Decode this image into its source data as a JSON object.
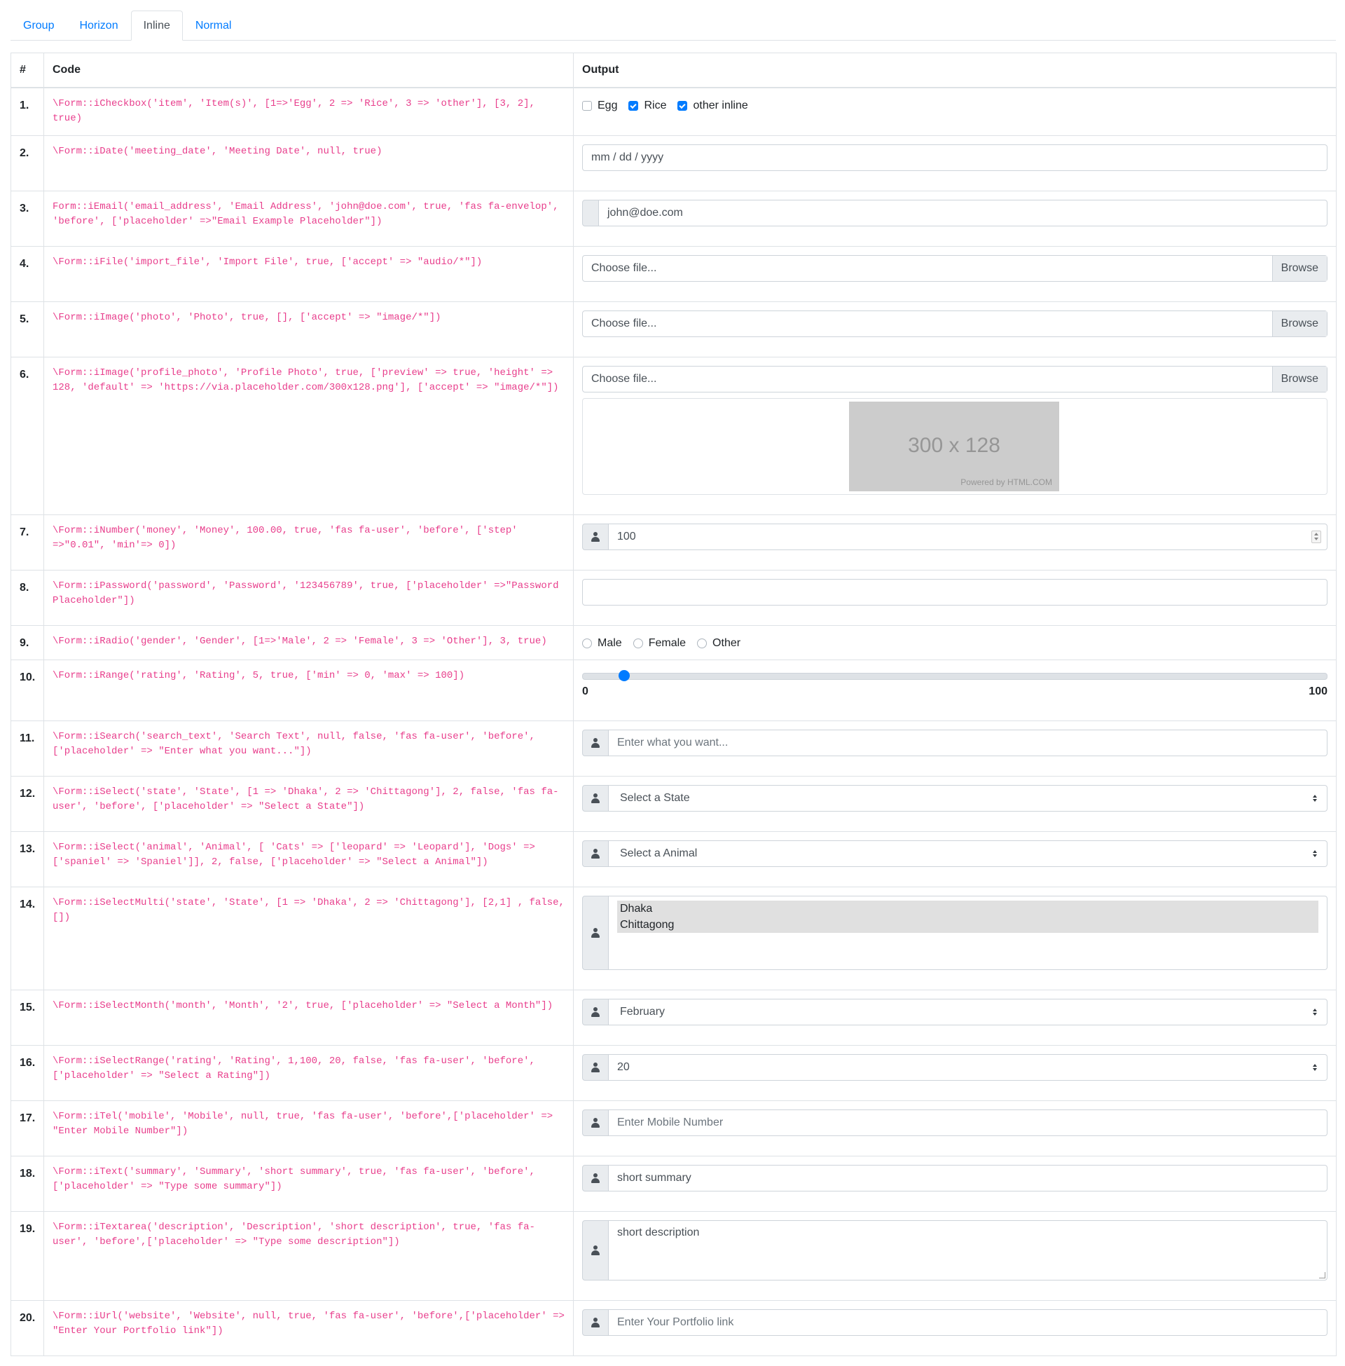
{
  "tabs": [
    {
      "label": "Group"
    },
    {
      "label": "Horizon"
    },
    {
      "label": "Inline"
    },
    {
      "label": "Normal"
    }
  ],
  "table": {
    "headers": {
      "num": "#",
      "code": "Code",
      "output": "Output"
    }
  },
  "rows": [
    {
      "num": "1.",
      "code": "\\Form::iCheckbox('item', 'Item(s)', [1=>'Egg', 2 => 'Rice', 3 => 'other'], [3, 2], true)",
      "options": [
        {
          "label": "Egg",
          "checked": false
        },
        {
          "label": "Rice",
          "checked": true
        },
        {
          "label": "other inline",
          "checked": true
        }
      ]
    },
    {
      "num": "2.",
      "code": "\\Form::iDate('meeting_date', 'Meeting Date', null, true)",
      "value": "mm / dd / yyyy"
    },
    {
      "num": "3.",
      "code": "Form::iEmail('email_address', 'Email Address', 'john@doe.com', true, 'fas fa-envelop', 'before', ['placeholder' =>\"Email Example Placeholder\"])",
      "value": "john@doe.com"
    },
    {
      "num": "4.",
      "code": "\\Form::iFile('import_file', 'Import File', true, ['accept' => \"audio/*\"])",
      "value": "Choose file...",
      "button": "Browse"
    },
    {
      "num": "5.",
      "code": "\\Form::iImage('photo', 'Photo', true, [], ['accept' => \"image/*\"])",
      "value": "Choose file...",
      "button": "Browse"
    },
    {
      "num": "6.",
      "code": "\\Form::iImage('profile_photo', 'Profile Photo', true, ['preview' => true, 'height' => 128, 'default' => 'https://via.placeholder.com/300x128.png'], ['accept' => \"image/*\"])",
      "value": "Choose file...",
      "button": "Browse",
      "preview_text": "300 x 128",
      "preview_credit": "Powered by HTML.COM"
    },
    {
      "num": "7.",
      "code": "\\Form::iNumber('money', 'Money', 100.00, true, 'fas fa-user', 'before', ['step' =>\"0.01\", 'min'=> 0])",
      "value": "100"
    },
    {
      "num": "8.",
      "code": "\\Form::iPassword('password', 'Password', '123456789', true, ['placeholder' =>\"Password Placeholder\"])",
      "value": ""
    },
    {
      "num": "9.",
      "code": "\\Form::iRadio('gender', 'Gender', [1=>'Male', 2 => 'Female', 3 => 'Other'], 3, true)",
      "options": [
        {
          "label": "Male"
        },
        {
          "label": "Female"
        },
        {
          "label": "Other"
        }
      ]
    },
    {
      "num": "10.",
      "code": "\\Form::iRange('rating', 'Rating', 5, true, ['min' => 0, 'max' => 100])",
      "min_label": "0",
      "max_label": "100",
      "value": 5
    },
    {
      "num": "11.",
      "code": "\\Form::iSearch('search_text', 'Search Text', null, false, 'fas fa-user', 'before', ['placeholder' => \"Enter what you want...\"])",
      "placeholder": "Enter what you want..."
    },
    {
      "num": "12.",
      "code": "\\Form::iSelect('state', 'State', [1 => 'Dhaka', 2 => 'Chittagong'], 2, false, 'fas fa-user', 'before', ['placeholder' => \"Select a State\"])",
      "value": "Select a State"
    },
    {
      "num": "13.",
      "code": "\\Form::iSelect('animal', 'Animal', [ 'Cats' => ['leopard' => 'Leopard'], 'Dogs' => ['spaniel' => 'Spaniel']], 2, false, ['placeholder' => \"Select a Animal\"])",
      "value": "Select a Animal"
    },
    {
      "num": "14.",
      "code": "\\Form::iSelectMulti('state', 'State', [1 => 'Dhaka', 2 => 'Chittagong'], [2,1] , false, [])",
      "options": [
        "Dhaka",
        "Chittagong"
      ]
    },
    {
      "num": "15.",
      "code": "\\Form::iSelectMonth('month', 'Month', '2', true, ['placeholder' => \"Select a Month\"])",
      "value": "February"
    },
    {
      "num": "16.",
      "code": "\\Form::iSelectRange('rating', 'Rating', 1,100, 20, false, 'fas fa-user', 'before', ['placeholder' => \"Select a Rating\"])",
      "value": "20"
    },
    {
      "num": "17.",
      "code": "\\Form::iTel('mobile', 'Mobile', null, true, 'fas fa-user', 'before',['placeholder' => \"Enter Mobile Number\"])",
      "placeholder": "Enter Mobile Number"
    },
    {
      "num": "18.",
      "code": "\\Form::iText('summary', 'Summary', 'short summary', true, 'fas fa-user', 'before', ['placeholder' => \"Type some summary\"])",
      "value": "short summary"
    },
    {
      "num": "19.",
      "code": "\\Form::iTextarea('description', 'Description', 'short description', true, 'fas fa-user', 'before',['placeholder' => \"Type some description\"])",
      "value": "short description"
    },
    {
      "num": "20.",
      "code": "\\Form::iUrl('website', 'Website', null, true, 'fas fa-user', 'before',['placeholder' => \"Enter Your Portfolio link\"])",
      "placeholder": "Enter Your Portfolio link"
    }
  ],
  "colors": {
    "accent": "#007bff",
    "code": "#e83e8c",
    "addon": "#e9ecef"
  },
  "active_tab": "Inline"
}
